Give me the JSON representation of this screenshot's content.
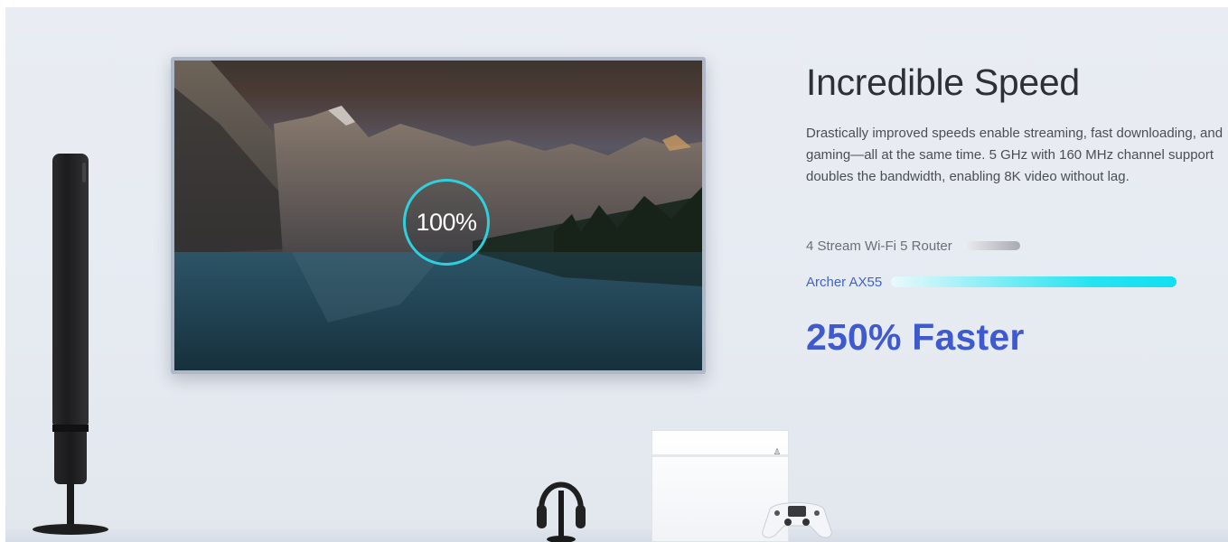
{
  "hero": {
    "title": "Incredible Speed",
    "description": "Drastically improved speeds enable streaming, fast downloading, and gaming—all at the same time. 5 GHz with 160 MHz channel support doubles the bandwidth, enabling 8K video without lag.",
    "speed_indicator": "100%",
    "comparison": [
      {
        "label": "4 Stream Wi-Fi 5 Router",
        "relative_speed": 0.2
      },
      {
        "label": "Archer AX55",
        "relative_speed": 1.0
      }
    ],
    "result": "250% Faster"
  },
  "colors": {
    "accent_blue": "#3f59cf",
    "ring_cyan": "#2fd0dc",
    "bar_cyan": "#12dff0",
    "bar_gray": "#a9abb2",
    "title_text": "#2d3036"
  },
  "icons": {
    "console_logo": "playstation-logo-icon"
  }
}
